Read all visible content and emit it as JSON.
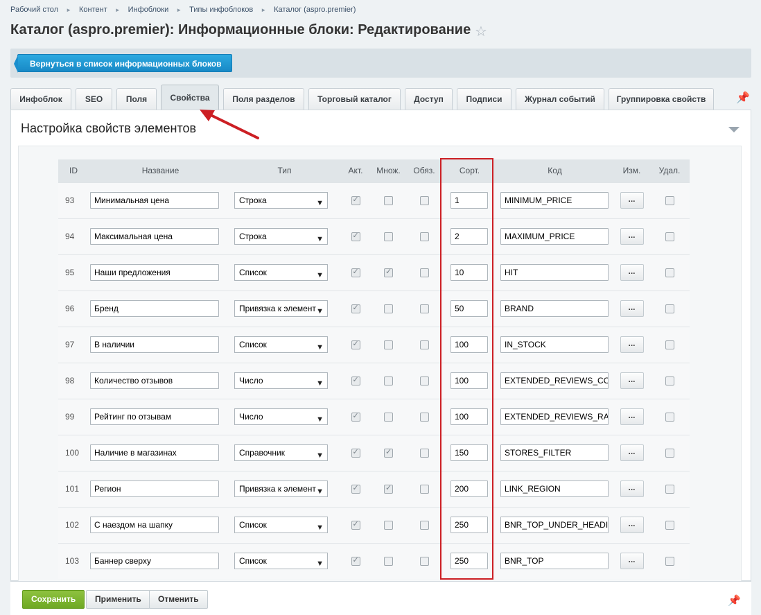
{
  "breadcrumbs": [
    "Рабочий стол",
    "Контент",
    "Инфоблоки",
    "Типы инфоблоков",
    "Каталог (aspro.premier)"
  ],
  "page_title": "Каталог (aspro.premier): Информационные блоки: Редактирование",
  "back_button": "Вернуться в список информационных блоков",
  "tabs": [
    "Инфоблок",
    "SEO",
    "Поля",
    "Свойства",
    "Поля разделов",
    "Торговый каталог",
    "Доступ",
    "Подписи",
    "Журнал событий",
    "Группировка свойств"
  ],
  "active_tab": "Свойства",
  "section_title": "Настройка свойств элементов",
  "table": {
    "headers": {
      "id": "ID",
      "name": "Название",
      "type": "Тип",
      "active": "Акт.",
      "multiple": "Множ.",
      "required": "Обяз.",
      "sort": "Сорт.",
      "code": "Код",
      "edit": "Изм.",
      "delete": "Удал."
    },
    "edit_label": "...",
    "rows": [
      {
        "id": "93",
        "name": "Минимальная цена",
        "type": "Строка",
        "active": true,
        "multiple": false,
        "required": false,
        "sort": "1",
        "code": "MINIMUM_PRICE"
      },
      {
        "id": "94",
        "name": "Максимальная цена",
        "type": "Строка",
        "active": true,
        "multiple": false,
        "required": false,
        "sort": "2",
        "code": "MAXIMUM_PRICE"
      },
      {
        "id": "95",
        "name": "Наши предложения",
        "type": "Список",
        "active": true,
        "multiple": true,
        "required": false,
        "sort": "10",
        "code": "HIT"
      },
      {
        "id": "96",
        "name": "Бренд",
        "type": "Привязка к элемент",
        "active": true,
        "multiple": false,
        "required": false,
        "sort": "50",
        "code": "BRAND"
      },
      {
        "id": "97",
        "name": "В наличии",
        "type": "Список",
        "active": true,
        "multiple": false,
        "required": false,
        "sort": "100",
        "code": "IN_STOCK"
      },
      {
        "id": "98",
        "name": "Количество отзывов",
        "type": "Число",
        "active": true,
        "multiple": false,
        "required": false,
        "sort": "100",
        "code": "EXTENDED_REVIEWS_CO"
      },
      {
        "id": "99",
        "name": "Рейтинг по отзывам",
        "type": "Число",
        "active": true,
        "multiple": false,
        "required": false,
        "sort": "100",
        "code": "EXTENDED_REVIEWS_RA"
      },
      {
        "id": "100",
        "name": "Наличие в магазинах",
        "type": "Справочник",
        "active": true,
        "multiple": true,
        "required": false,
        "sort": "150",
        "code": "STORES_FILTER"
      },
      {
        "id": "101",
        "name": "Регион",
        "type": "Привязка к элемент",
        "active": true,
        "multiple": true,
        "required": false,
        "sort": "200",
        "code": "LINK_REGION"
      },
      {
        "id": "102",
        "name": "С наездом на шапку",
        "type": "Список",
        "active": true,
        "multiple": false,
        "required": false,
        "sort": "250",
        "code": "BNR_TOP_UNDER_HEADI"
      },
      {
        "id": "103",
        "name": "Баннер сверху",
        "type": "Список",
        "active": true,
        "multiple": false,
        "required": false,
        "sort": "250",
        "code": "BNR_TOP"
      }
    ]
  },
  "footer": {
    "save": "Сохранить",
    "apply": "Применить",
    "cancel": "Отменить"
  },
  "colors": {
    "accent_blue": "#1889c6",
    "save_green": "#6ea823",
    "highlight_red": "#cc1f24"
  }
}
